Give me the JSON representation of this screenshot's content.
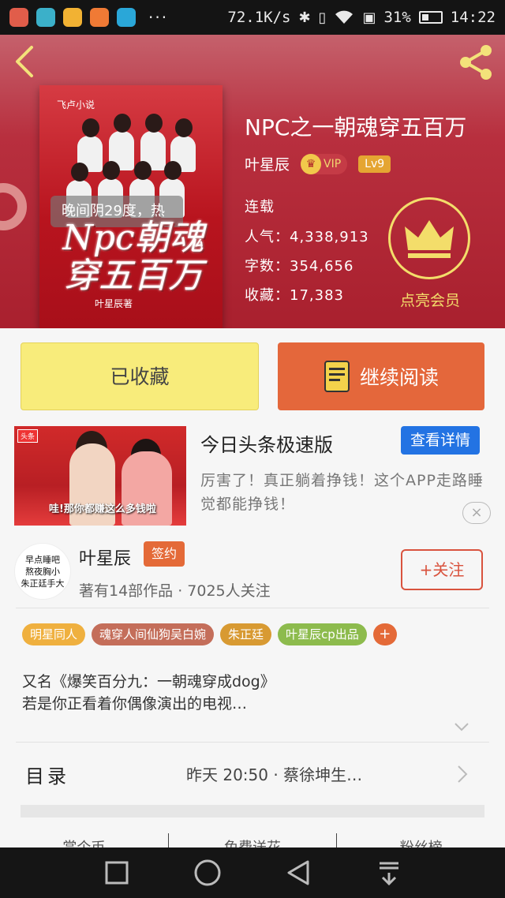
{
  "status_bar": {
    "speed": "72.1K/s",
    "battery_pct": "31%",
    "time": "14:22",
    "dots": "···",
    "app_icons": [
      "#e15d4a",
      "#3bb0c9",
      "#f2b233",
      "#f07a35",
      "#2aa7d8"
    ]
  },
  "book": {
    "title": "NPC之一朝魂穿五百万",
    "author": "叶星辰",
    "vip": "VIP",
    "level": "Lv9",
    "status": "连载",
    "popularity": "人气：4,338,913",
    "word_count": "字数：354,656",
    "favorites": "收藏：17,383",
    "member_label": "点亮会员"
  },
  "cover": {
    "publisher": "飞卢小说",
    "weather_overlay": "晚间阴29度，热",
    "title_art": "Npc朝魂穿五百万",
    "author": "叶星辰著"
  },
  "actions": {
    "collected": "已收藏",
    "continue_reading": "继续阅读"
  },
  "ad": {
    "tag": "头条",
    "caption": "哇!那你都赚这么多钱啦",
    "title": "今日头条极速版",
    "detail_button": "查看详情",
    "description": "厉害了！真正躺着挣钱！这个APP走路睡觉都能挣钱！",
    "close": "×"
  },
  "author_info": {
    "avatar_lines": [
      "早点睡吧",
      "熬夜胸小",
      "朱正廷手大"
    ],
    "name": "叶星辰",
    "signed_badge": "签约",
    "works": "著有14部作品 · 7025人关注",
    "follow_button": "+关注"
  },
  "tags": [
    {
      "label": "明星同人",
      "color": "#efb03f"
    },
    {
      "label": "魂穿人间仙狗吴白婉",
      "color": "#c46e5a"
    },
    {
      "label": "朱正廷",
      "color": "#d89a32"
    },
    {
      "label": "叶星辰cp出品",
      "color": "#8dbb4d"
    }
  ],
  "tag_add": "+",
  "intro": {
    "line1": "又名《爆笑百分九：一朝魂穿成dog》",
    "line2": "若是你正看着你偶像演出的电视…"
  },
  "toc": {
    "label": "目录",
    "latest": "昨天 20:50 · 蔡徐坤生…"
  },
  "bottom_tabs": [
    "赏个币",
    "免费送花",
    "粉丝榜"
  ],
  "colors": {
    "header_red": "#b82f3e",
    "accent_orange": "#e4673b",
    "gold": "#f3dd6a",
    "collected_yellow": "#f8ec7b",
    "ad_blue": "#2373e3"
  }
}
